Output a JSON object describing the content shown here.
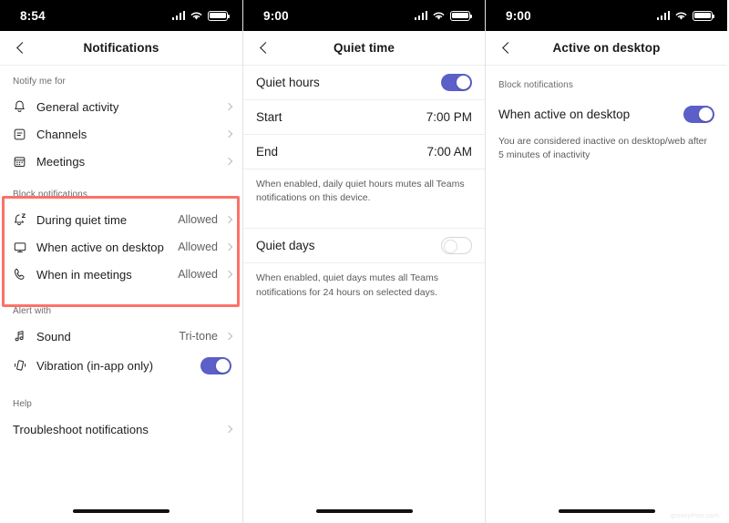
{
  "colors": {
    "accent": "#5b5fc7",
    "highlight": "#fa7268",
    "text_primary": "#1d1d1d",
    "text_secondary": "#616161",
    "statusbar_bg": "#000000"
  },
  "watermark": "groovyPost.com",
  "screens": [
    {
      "id": "notifications",
      "statusbar": {
        "clock": "8:54",
        "signal_icon": "signal-bars-icon",
        "wifi_icon": "wifi-icon",
        "battery_icon": "battery-icon"
      },
      "nav": {
        "back_icon": "chevron-left-icon",
        "title": "Notifications"
      },
      "sections": [
        {
          "label": "Notify me for",
          "rows": [
            {
              "icon": "bell-icon",
              "label": "General activity",
              "value": "",
              "chevron": true
            },
            {
              "icon": "channels-icon",
              "label": "Channels",
              "value": "",
              "chevron": true
            },
            {
              "icon": "calendar-icon",
              "label": "Meetings",
              "value": "",
              "chevron": true
            }
          ]
        },
        {
          "label": "Block notifications",
          "highlighted": true,
          "rows": [
            {
              "icon": "bell-snooze-icon",
              "label": "During quiet time",
              "value": "Allowed",
              "chevron": true
            },
            {
              "icon": "monitor-icon",
              "label": "When active on desktop",
              "value": "Allowed",
              "chevron": true
            },
            {
              "icon": "phone-call-icon",
              "label": "When in meetings",
              "value": "Allowed",
              "chevron": true
            }
          ]
        },
        {
          "label": "Alert with",
          "rows": [
            {
              "icon": "music-note-icon",
              "label": "Sound",
              "value": "Tri-tone",
              "chevron": true
            },
            {
              "icon": "vibration-icon",
              "label": "Vibration (in-app only)",
              "value": "",
              "toggle": "on"
            }
          ]
        },
        {
          "label": "Help",
          "rows": [
            {
              "icon": "",
              "label": "Troubleshoot notifications",
              "value": "",
              "chevron": true
            }
          ]
        }
      ]
    },
    {
      "id": "quiet-time",
      "statusbar": {
        "clock": "9:00",
        "signal_icon": "signal-bars-icon",
        "wifi_icon": "wifi-icon",
        "battery_icon": "battery-icon"
      },
      "nav": {
        "back_icon": "chevron-left-icon",
        "title": "Quiet time"
      },
      "rows": [
        {
          "label": "Quiet hours",
          "toggle": "on"
        },
        {
          "label": "Start",
          "value": "7:00 PM"
        },
        {
          "label": "End",
          "value": "7:00 AM"
        }
      ],
      "help_1": "When enabled, daily quiet hours mutes all Teams notifications on this device.",
      "quiet_days": {
        "label": "Quiet days",
        "toggle": "off"
      },
      "help_2": "When enabled, quiet days mutes all Teams notifications for 24 hours on selected days."
    },
    {
      "id": "active-on-desktop",
      "statusbar": {
        "clock": "9:00",
        "signal_icon": "signal-bars-icon",
        "wifi_icon": "wifi-icon",
        "battery_icon": "battery-icon"
      },
      "nav": {
        "back_icon": "chevron-left-icon",
        "title": "Active on desktop"
      },
      "section_label": "Block notifications",
      "row": {
        "label": "When active on desktop",
        "toggle": "on"
      },
      "help": "You are considered inactive on desktop/web after 5 minutes of inactivity"
    }
  ]
}
